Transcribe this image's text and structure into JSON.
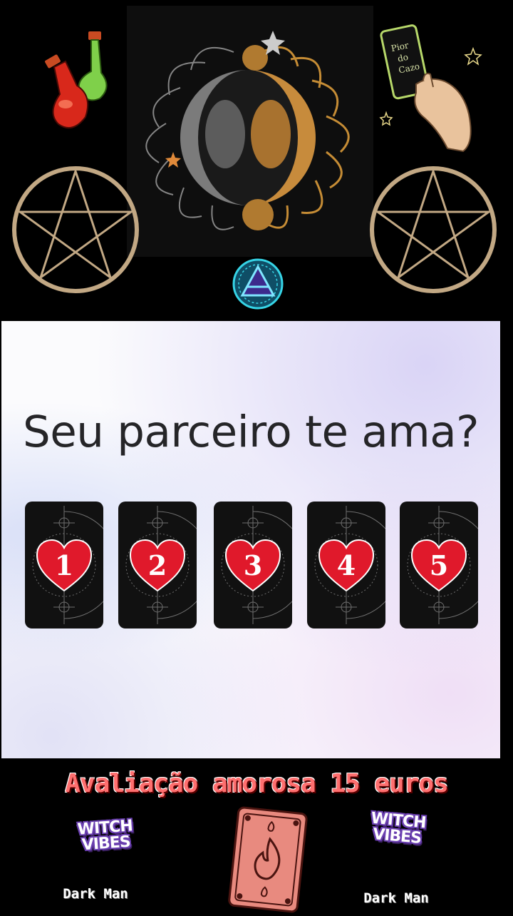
{
  "art": {
    "potion_label": "",
    "hand_card_text": [
      "Pior",
      "do",
      "Cazo"
    ]
  },
  "question": "Seu parceiro te ama?",
  "cards": [
    {
      "number": "1"
    },
    {
      "number": "2"
    },
    {
      "number": "3"
    },
    {
      "number": "4"
    },
    {
      "number": "5"
    }
  ],
  "footer": {
    "price_text": "Avaliação amorosa 15 euros",
    "badge_left": {
      "line1": "WITCH",
      "line2": "VIBES",
      "caption": "Dark Man"
    },
    "badge_right": {
      "line1": "WITCH",
      "line2": "VIBES",
      "caption": "Dark Man"
    }
  },
  "colors": {
    "background": "#000000",
    "card_back": "#111111",
    "heart": "#e0192b",
    "price_text": "#ff6f6f",
    "pentagram": "#c2a884"
  }
}
